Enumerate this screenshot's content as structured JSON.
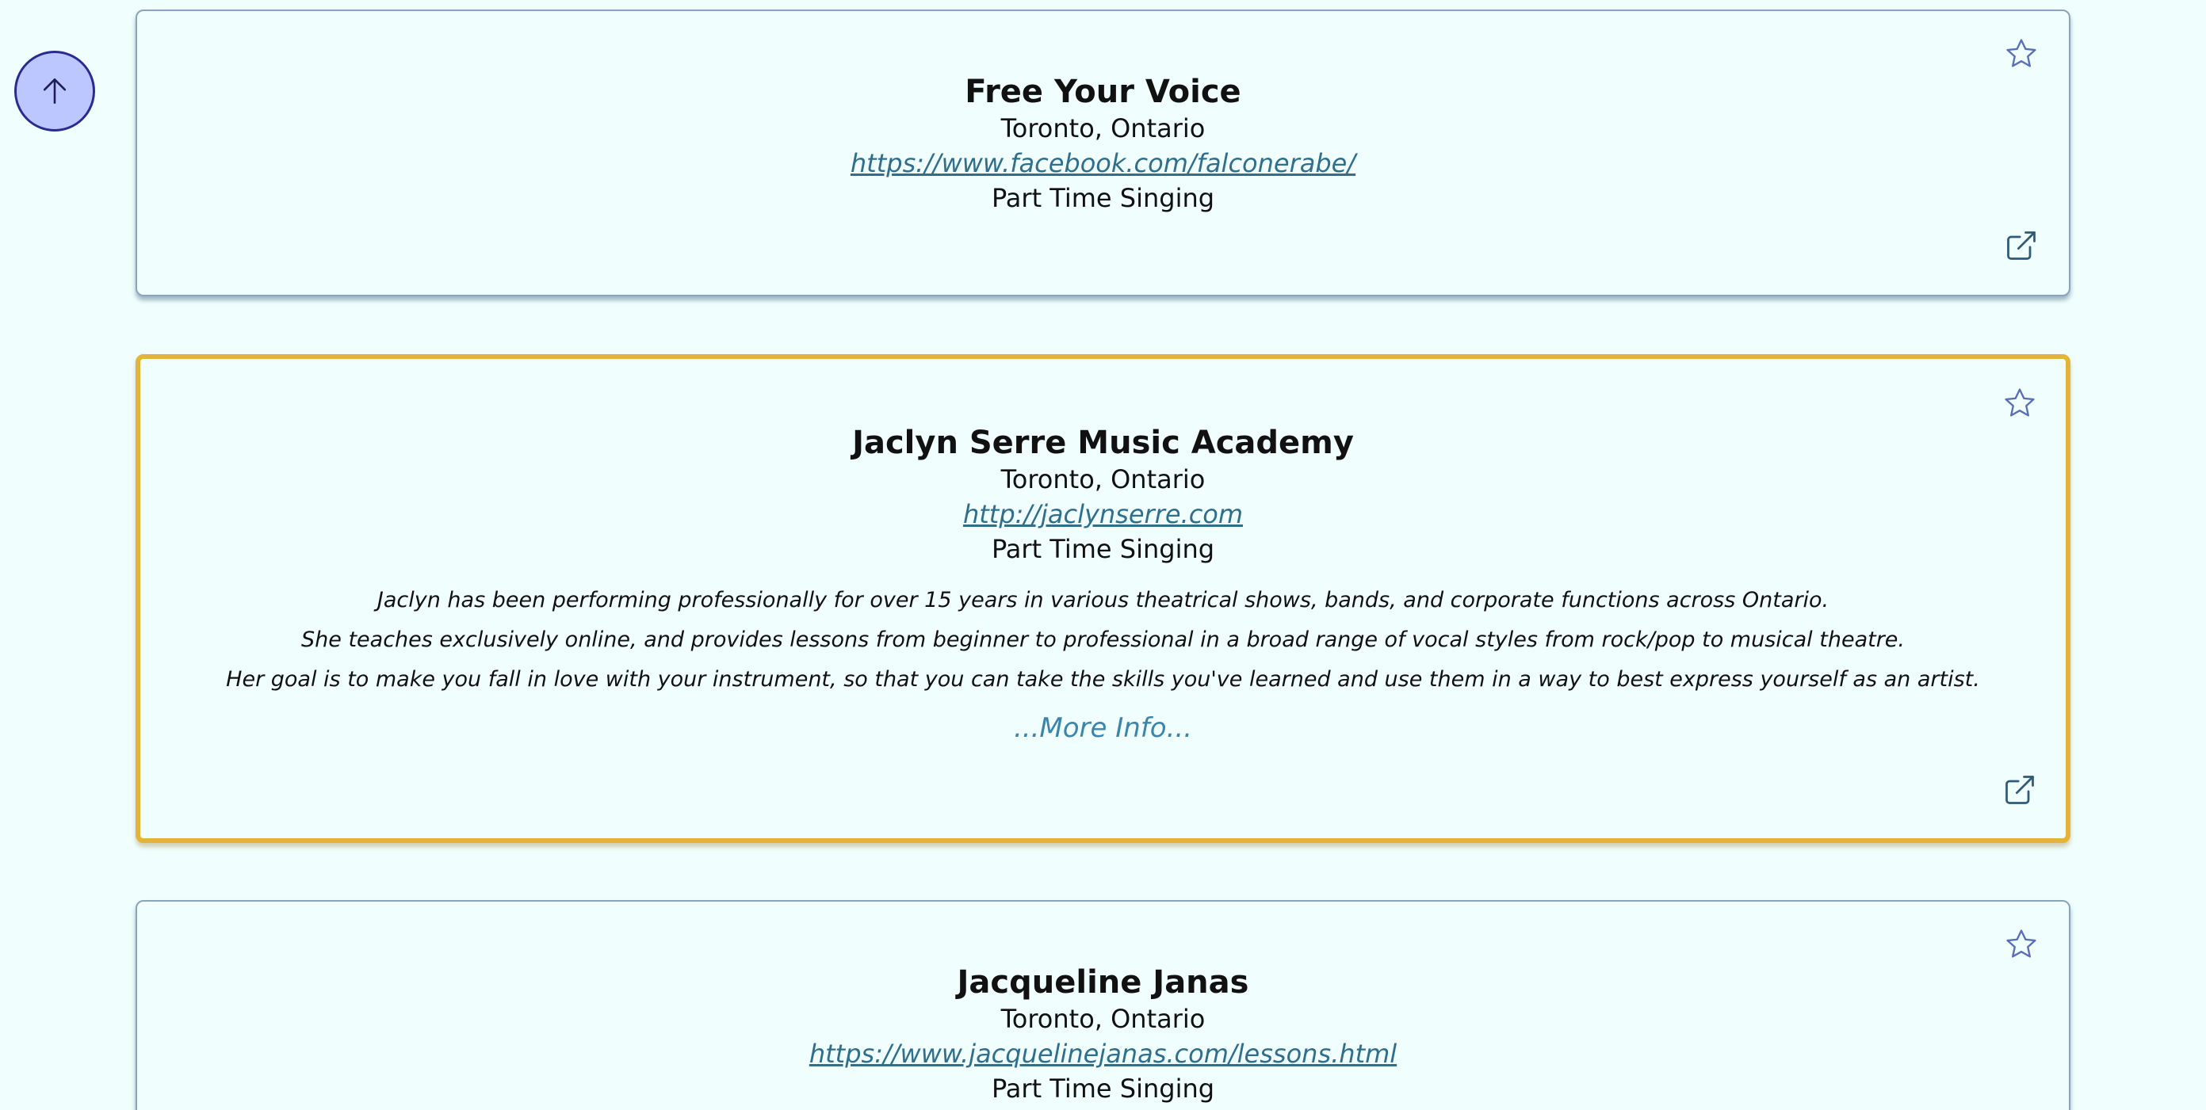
{
  "scroll_top": {
    "icon": "arrow-up-icon"
  },
  "cards": [
    {
      "title": "Free Your Voice",
      "location": "Toronto, Ontario",
      "url": "https://www.facebook.com/falconerabe/",
      "type": "Part Time Singing",
      "featured": false
    },
    {
      "title": "Jaclyn Serre Music Academy",
      "location": "Toronto, Ontario",
      "url": "http://jaclynserre.com",
      "type": "Part Time Singing",
      "featured": true,
      "description": [
        "Jaclyn has been performing professionally for over 15 years in various theatrical shows, bands, and corporate functions across Ontario.",
        "She teaches exclusively online, and provides lessons from beginner to professional in a broad range of vocal styles from rock/pop to musical theatre.",
        "Her goal is to make you fall in love with your instrument, so that you can take the skills you've learned and use them in a way to best express yourself as an artist."
      ],
      "more_info": "...More Info..."
    },
    {
      "title": "Jacqueline Janas",
      "location": "Toronto, Ontario",
      "url": "https://www.jacquelinejanas.com/lessons.html",
      "type": "Part Time Singing",
      "featured": false
    }
  ],
  "icons": {
    "favorite": "star-outline-icon",
    "open": "external-link-icon"
  },
  "colors": {
    "background": "#f0fffe",
    "featured_border": "#e3b33b",
    "link": "#2f6e8c",
    "more_info": "#3b84ab",
    "icon": "#5a6fb8",
    "scroll_button_fill": "#bcc6ff"
  }
}
